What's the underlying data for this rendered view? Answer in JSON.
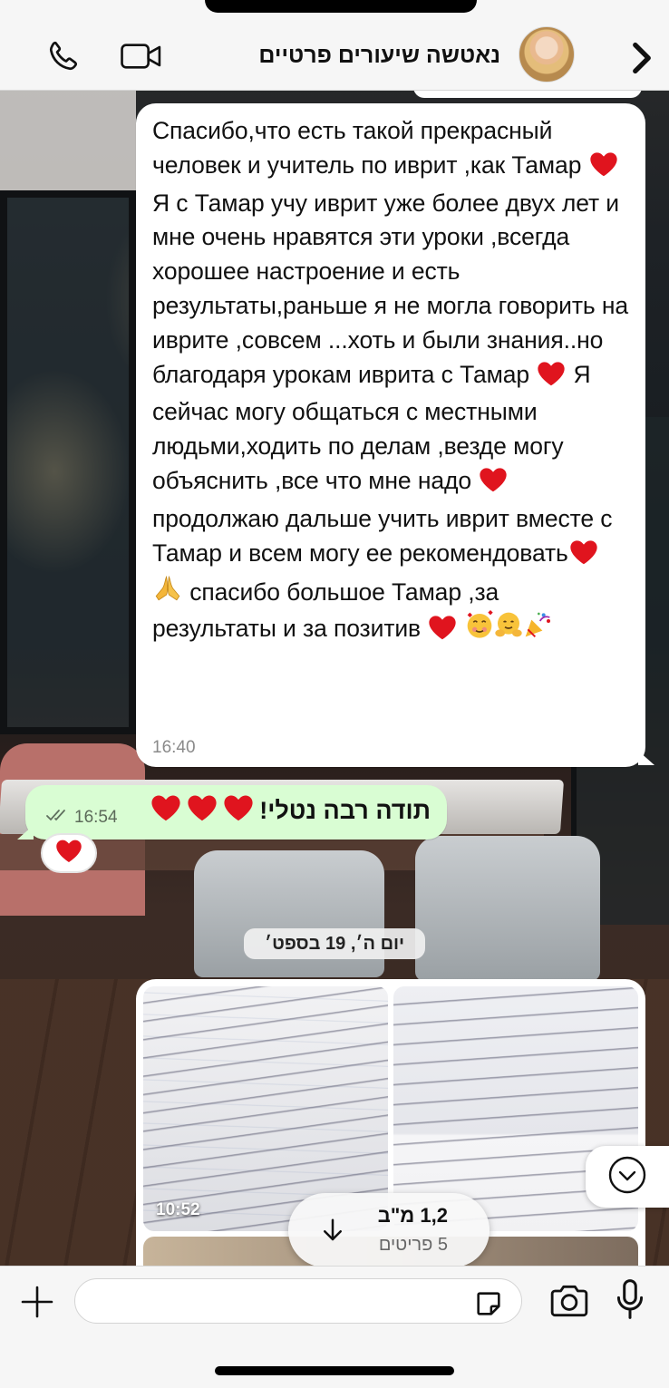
{
  "header": {
    "title": "נאטשה שיעורים פרטיים",
    "avatar_alt": "contact-avatar"
  },
  "messages": {
    "incoming": {
      "parts": [
        "Спасибо,что есть такой прекрасный человек и учитель по иврит ,как Тамар ",
        "Я с Тамар учу иврит уже более двух лет и мне очень нравятся эти уроки ,всегда хорошее настроение и есть результаты,раньше я не могла говорить на иврите ,совсем ...хоть и были знания..но благодаря урокам иврита с Тамар ",
        " Я сейчас могу общаться с местными людьми,ходить по делам ,везде могу объяснить ,все что мне надо ",
        "продолжаю дальше учить иврит вместе с Тамар и всем могу ее рекомендовать",
        " спасибо большое Тамар ,за результаты и за позитив "
      ],
      "time": "16:40"
    },
    "outgoing": {
      "text": "תודה רבה נטלי!",
      "time": "16:54",
      "reaction": "heart"
    }
  },
  "date_chip": {
    "weekday": "יום ה׳,",
    "date": "19 בספט׳"
  },
  "media": {
    "time": "10:52",
    "download_size": "1,2 מ\"ב",
    "download_items": "5 פריטים"
  },
  "composer": {
    "placeholder": ""
  },
  "colors": {
    "outgoing_bubble": "#d9fdd3",
    "incoming_bubble": "#ffffff",
    "heart": "#e0141e",
    "header_bg": "#f6f6f6"
  },
  "icons": [
    "phone-icon",
    "video-icon",
    "back-chevron-icon",
    "heart-icon",
    "double-check-icon",
    "download-icon",
    "chevron-down-icon",
    "plus-icon",
    "sticker-icon",
    "camera-icon",
    "mic-icon"
  ]
}
